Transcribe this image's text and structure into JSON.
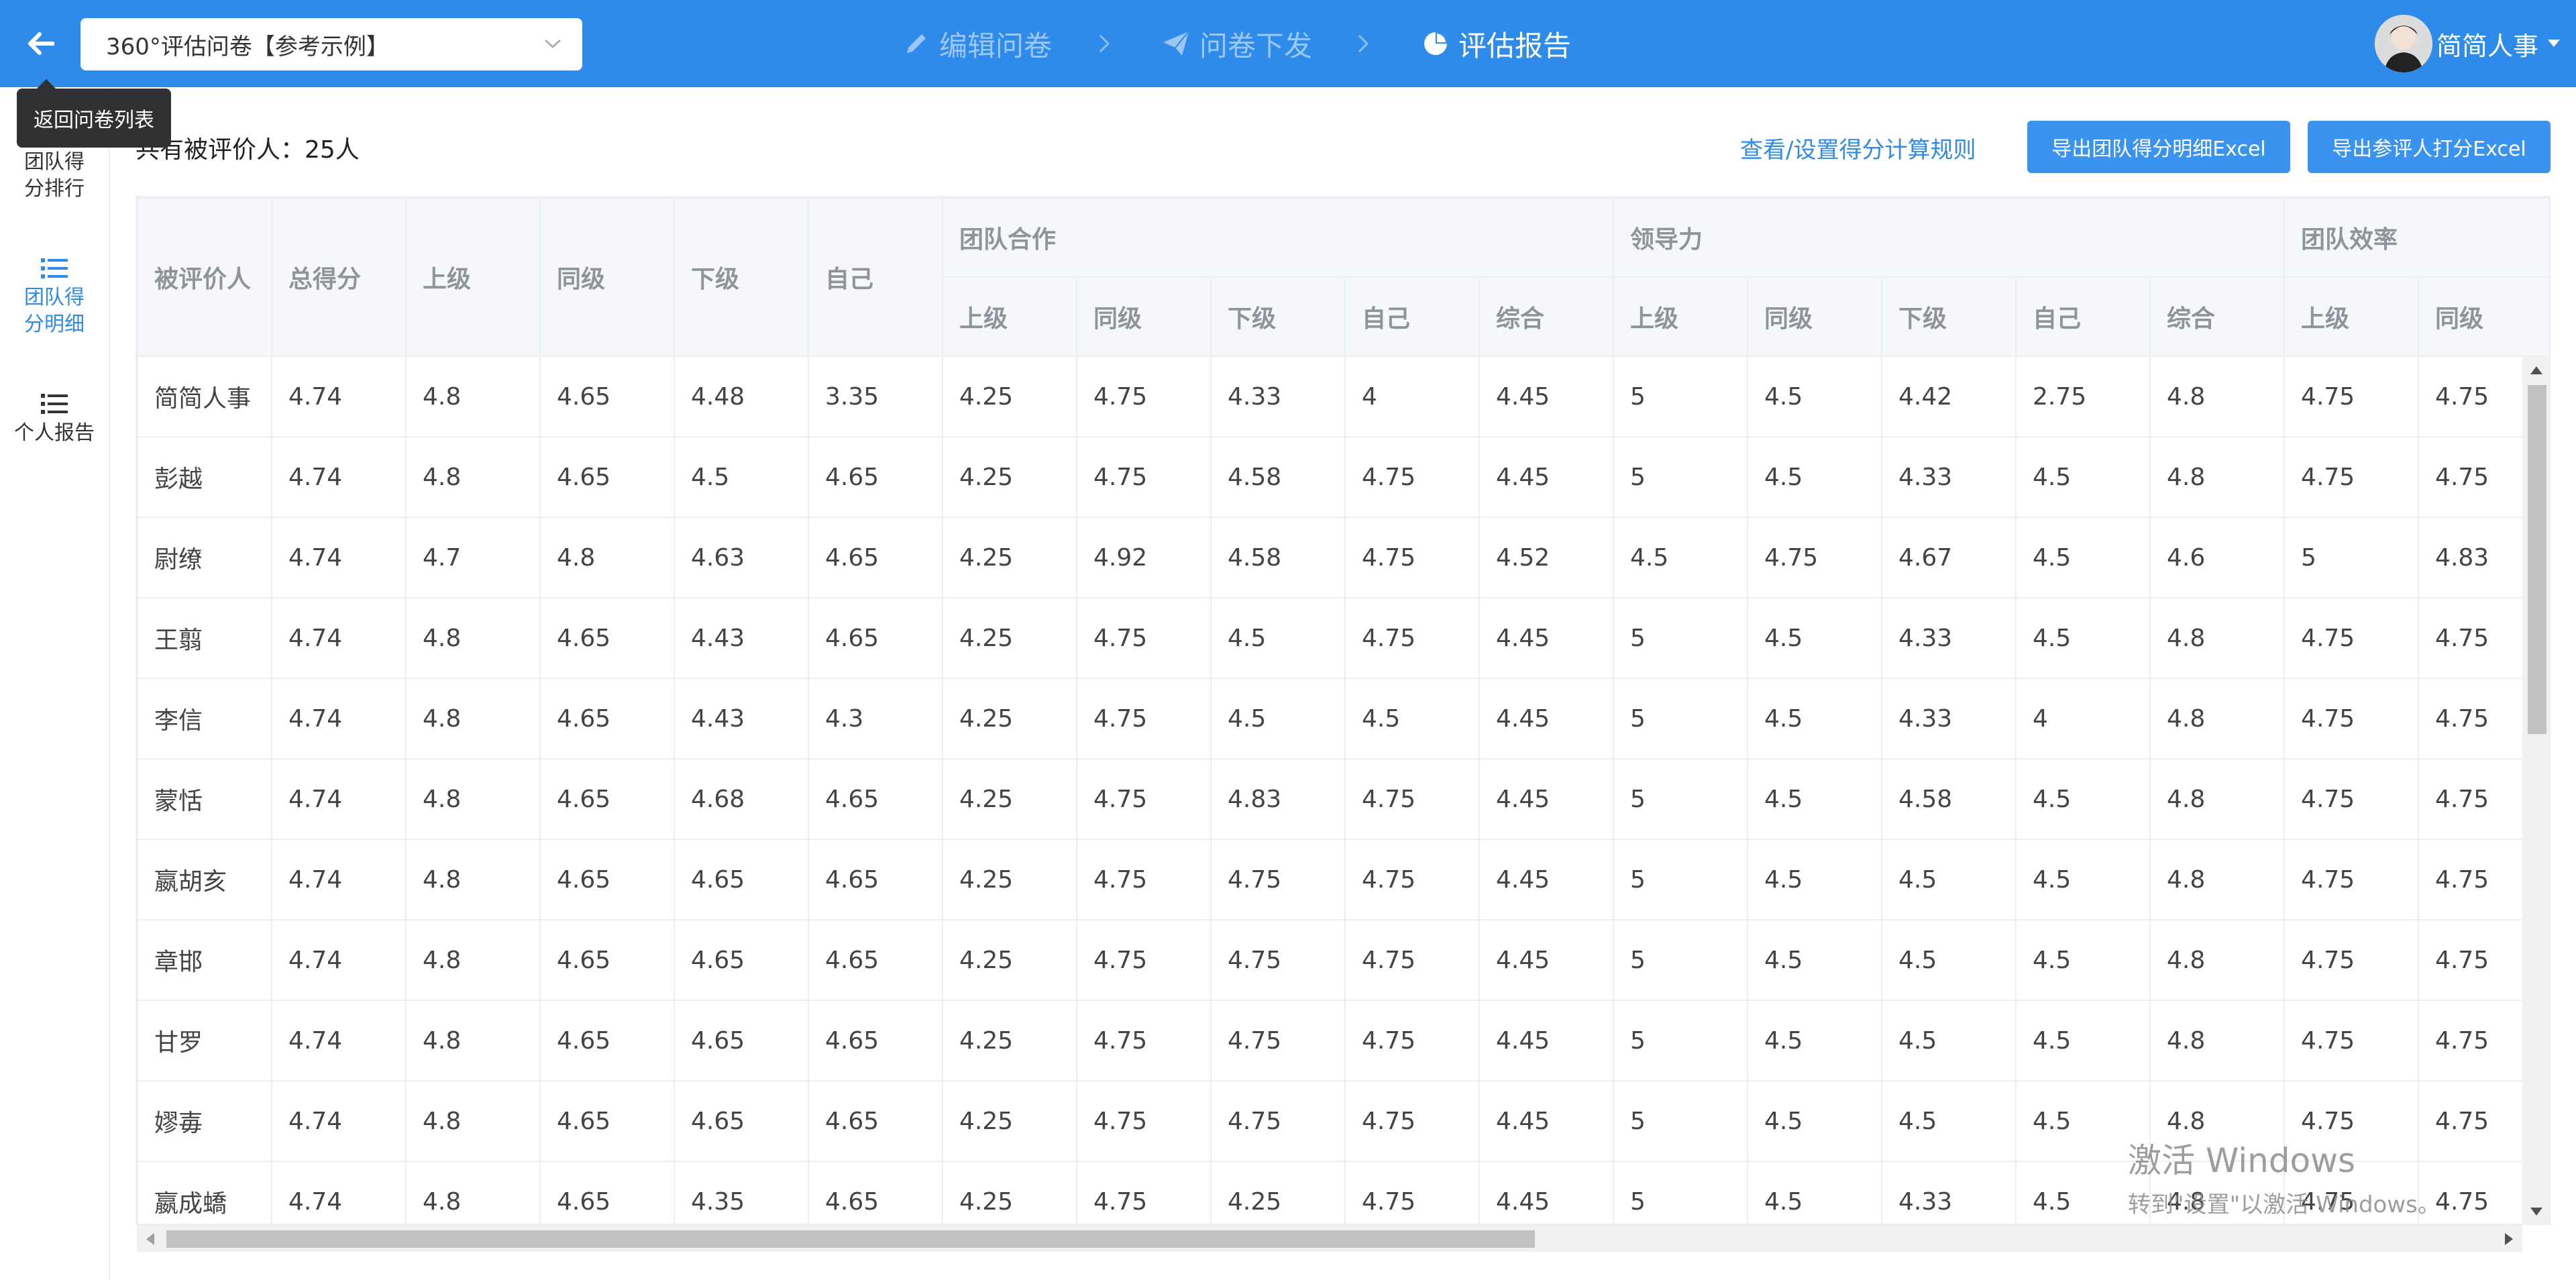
{
  "header": {
    "survey_select": "360°评估问卷【参考示例】",
    "steps": [
      {
        "label": "编辑问卷",
        "icon": "pencil-icon"
      },
      {
        "label": "问卷下发",
        "icon": "paper-plane-icon"
      },
      {
        "label": "评估报告",
        "icon": "pie-chart-icon"
      }
    ],
    "user_name": "简简人事"
  },
  "tooltip": "返回问卷列表",
  "sidebar": {
    "items": [
      {
        "label": "团队得分排行",
        "icon": "sort-icon"
      },
      {
        "label": "团队得分明细",
        "icon": "list-icon"
      },
      {
        "label": "个人报告",
        "icon": "list-icon"
      }
    ]
  },
  "summary": {
    "count_text": "共有被评价人：25人"
  },
  "actions": {
    "rules_link": "查看/设置得分计算规则",
    "export_team": "导出团队得分明细Excel",
    "export_raters": "导出参评人打分Excel"
  },
  "table": {
    "base_headers": [
      "被评价人",
      "总得分",
      "上级",
      "同级",
      "下级",
      "自己"
    ],
    "groups": [
      "团队合作",
      "领导力",
      "团队效率"
    ],
    "sub_headers": [
      "上级",
      "同级",
      "下级",
      "自己",
      "综合",
      "上级",
      "同级",
      "下级",
      "自己",
      "综合",
      "上级",
      "同级"
    ],
    "rows": [
      [
        "简简人事",
        "4.74",
        "4.8",
        "4.65",
        "4.48",
        "3.35",
        "4.25",
        "4.75",
        "4.33",
        "4",
        "4.45",
        "5",
        "4.5",
        "4.42",
        "2.75",
        "4.8",
        "4.75",
        "4.75"
      ],
      [
        "彭越",
        "4.74",
        "4.8",
        "4.65",
        "4.5",
        "4.65",
        "4.25",
        "4.75",
        "4.58",
        "4.75",
        "4.45",
        "5",
        "4.5",
        "4.33",
        "4.5",
        "4.8",
        "4.75",
        "4.75"
      ],
      [
        "尉缭",
        "4.74",
        "4.7",
        "4.8",
        "4.63",
        "4.65",
        "4.25",
        "4.92",
        "4.58",
        "4.75",
        "4.52",
        "4.5",
        "4.75",
        "4.67",
        "4.5",
        "4.6",
        "5",
        "4.83"
      ],
      [
        "王翦",
        "4.74",
        "4.8",
        "4.65",
        "4.43",
        "4.65",
        "4.25",
        "4.75",
        "4.5",
        "4.75",
        "4.45",
        "5",
        "4.5",
        "4.33",
        "4.5",
        "4.8",
        "4.75",
        "4.75"
      ],
      [
        "李信",
        "4.74",
        "4.8",
        "4.65",
        "4.43",
        "4.3",
        "4.25",
        "4.75",
        "4.5",
        "4.5",
        "4.45",
        "5",
        "4.5",
        "4.33",
        "4",
        "4.8",
        "4.75",
        "4.75"
      ],
      [
        "蒙恬",
        "4.74",
        "4.8",
        "4.65",
        "4.68",
        "4.65",
        "4.25",
        "4.75",
        "4.83",
        "4.75",
        "4.45",
        "5",
        "4.5",
        "4.58",
        "4.5",
        "4.8",
        "4.75",
        "4.75"
      ],
      [
        "嬴胡亥",
        "4.74",
        "4.8",
        "4.65",
        "4.65",
        "4.65",
        "4.25",
        "4.75",
        "4.75",
        "4.75",
        "4.45",
        "5",
        "4.5",
        "4.5",
        "4.5",
        "4.8",
        "4.75",
        "4.75"
      ],
      [
        "章邯",
        "4.74",
        "4.8",
        "4.65",
        "4.65",
        "4.65",
        "4.25",
        "4.75",
        "4.75",
        "4.75",
        "4.45",
        "5",
        "4.5",
        "4.5",
        "4.5",
        "4.8",
        "4.75",
        "4.75"
      ],
      [
        "甘罗",
        "4.74",
        "4.8",
        "4.65",
        "4.65",
        "4.65",
        "4.25",
        "4.75",
        "4.75",
        "4.75",
        "4.45",
        "5",
        "4.5",
        "4.5",
        "4.5",
        "4.8",
        "4.75",
        "4.75"
      ],
      [
        "嫪毐",
        "4.74",
        "4.8",
        "4.65",
        "4.65",
        "4.65",
        "4.25",
        "4.75",
        "4.75",
        "4.75",
        "4.45",
        "5",
        "4.5",
        "4.5",
        "4.5",
        "4.8",
        "4.75",
        "4.75"
      ],
      [
        "嬴成蟜",
        "4.74",
        "4.8",
        "4.65",
        "4.35",
        "4.65",
        "4.25",
        "4.75",
        "4.25",
        "4.75",
        "4.45",
        "5",
        "4.5",
        "4.33",
        "4.5",
        "4.8",
        "4.75",
        "4.75"
      ]
    ]
  },
  "watermark": {
    "line1": "激活 Windows",
    "line2": "转到\"设置\"以激活 Windows。"
  },
  "colors": {
    "brand": "#2e8bea",
    "header_bg": "#f5f7fa",
    "border": "#ebeef5"
  }
}
